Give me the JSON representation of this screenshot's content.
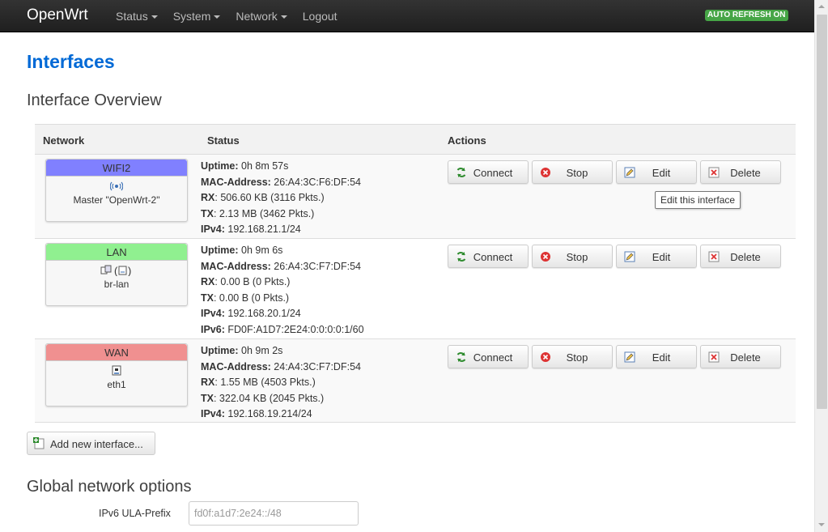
{
  "navbar": {
    "brand": "OpenWrt",
    "menu": [
      "Status",
      "System",
      "Network",
      "Logout"
    ],
    "autorefresh": "AUTO REFRESH ON"
  },
  "page": {
    "title": "Interfaces",
    "subtitle": "Interface Overview"
  },
  "table": {
    "headers": {
      "network": "Network",
      "status": "Status",
      "actions": "Actions"
    },
    "rows": [
      {
        "name": "WIFI2",
        "color": "#8080ff",
        "device_label": "Master \"OpenWrt-2\"",
        "icon": "wifi-icon",
        "status": [
          {
            "k": "Uptime:",
            "v": " 0h 8m 57s"
          },
          {
            "k": "MAC-Address:",
            "v": " 26:A4:3C:F6:DF:54"
          },
          {
            "k": "RX",
            "v": ": 506.60 KB (3116 Pkts.)"
          },
          {
            "k": "TX",
            "v": ": 2.13 MB (3462 Pkts.)"
          },
          {
            "k": "IPv4:",
            "v": " 192.168.21.1/24"
          }
        ]
      },
      {
        "name": "LAN",
        "color": "#90f090",
        "device_label": "br-lan",
        "icon": "bridge-icon",
        "status": [
          {
            "k": "Uptime:",
            "v": " 0h 9m 6s"
          },
          {
            "k": "MAC-Address:",
            "v": " 26:A4:3C:F7:DF:54"
          },
          {
            "k": "RX",
            "v": ": 0.00 B (0 Pkts.)"
          },
          {
            "k": "TX",
            "v": ": 0.00 B (0 Pkts.)"
          },
          {
            "k": "IPv4:",
            "v": " 192.168.20.1/24"
          },
          {
            "k": "IPv6:",
            "v": " FD0F:A1D7:2E24:0:0:0:0:1/60"
          }
        ]
      },
      {
        "name": "WAN",
        "color": "#f09090",
        "device_label": "eth1",
        "icon": "ethernet-icon",
        "status": [
          {
            "k": "Uptime:",
            "v": " 0h 9m 2s"
          },
          {
            "k": "MAC-Address:",
            "v": " 24:A4:3C:F7:DF:54"
          },
          {
            "k": "RX",
            "v": ": 1.55 MB (4503 Pkts.)"
          },
          {
            "k": "TX",
            "v": ": 322.04 KB (2045 Pkts.)"
          },
          {
            "k": "IPv4:",
            "v": " 192.168.19.214/24"
          }
        ]
      }
    ],
    "actions": {
      "connect": "Connect",
      "stop": "Stop",
      "edit": "Edit",
      "delete": "Delete"
    },
    "tooltip": "Edit this interface"
  },
  "add_interface": "Add new interface...",
  "global": {
    "title": "Global network options",
    "ula_label": "IPv6 ULA-Prefix",
    "ula_value": "fd0f:a1d7:2e24::/48"
  }
}
